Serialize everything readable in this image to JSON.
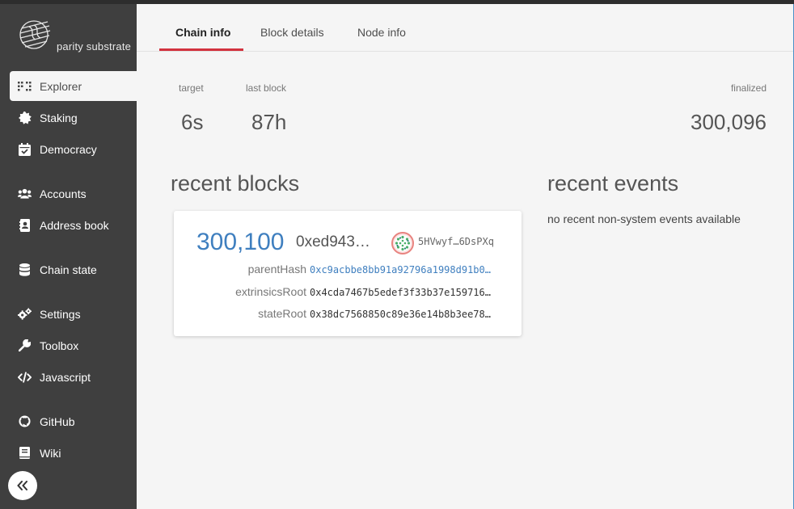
{
  "app": {
    "logo_text": "parity substrate"
  },
  "sidebar": {
    "items": [
      {
        "label": "Explorer",
        "icon": "grid-icon"
      },
      {
        "label": "Staking",
        "icon": "certificate-icon"
      },
      {
        "label": "Democracy",
        "icon": "calendar-check-icon"
      },
      {
        "label": "Accounts",
        "icon": "users-icon"
      },
      {
        "label": "Address book",
        "icon": "address-book-icon"
      },
      {
        "label": "Chain state",
        "icon": "database-icon"
      },
      {
        "label": "Settings",
        "icon": "gears-icon"
      },
      {
        "label": "Toolbox",
        "icon": "wrench-icon"
      },
      {
        "label": "Javascript",
        "icon": "code-icon"
      },
      {
        "label": "GitHub",
        "icon": "github-icon"
      },
      {
        "label": "Wiki",
        "icon": "book-icon"
      }
    ],
    "collapse_icon": "double-chevron-left-icon"
  },
  "tabs": [
    {
      "label": "Chain info"
    },
    {
      "label": "Block details"
    },
    {
      "label": "Node info"
    }
  ],
  "summary": {
    "target": {
      "label": "target",
      "value": "6s"
    },
    "last_block": {
      "label": "last block",
      "value": "87h"
    },
    "finalized": {
      "label": "finalized",
      "value": "300,096"
    }
  },
  "recent_blocks": {
    "title": "recent blocks",
    "block": {
      "number": "300,100",
      "hash": "0xed943…",
      "author": "5HVwyf…6DsPXq",
      "rows": [
        {
          "label": "parentHash",
          "value": "0xc9acbbe8bb91a92796a1998d91b0…"
        },
        {
          "label": "extrinsicsRoot",
          "value": "0x4cda7467b5edef3f33b37e159716…"
        },
        {
          "label": "stateRoot",
          "value": "0x38dc7568850c89e36e14b8b3ee78…"
        }
      ]
    }
  },
  "recent_events": {
    "title": "recent events",
    "empty_text": "no recent non-system events available"
  },
  "colors": {
    "sidebar_bg": "#3f3f3f",
    "accent_red": "#d2323e",
    "link_blue": "#3f7fbf"
  }
}
